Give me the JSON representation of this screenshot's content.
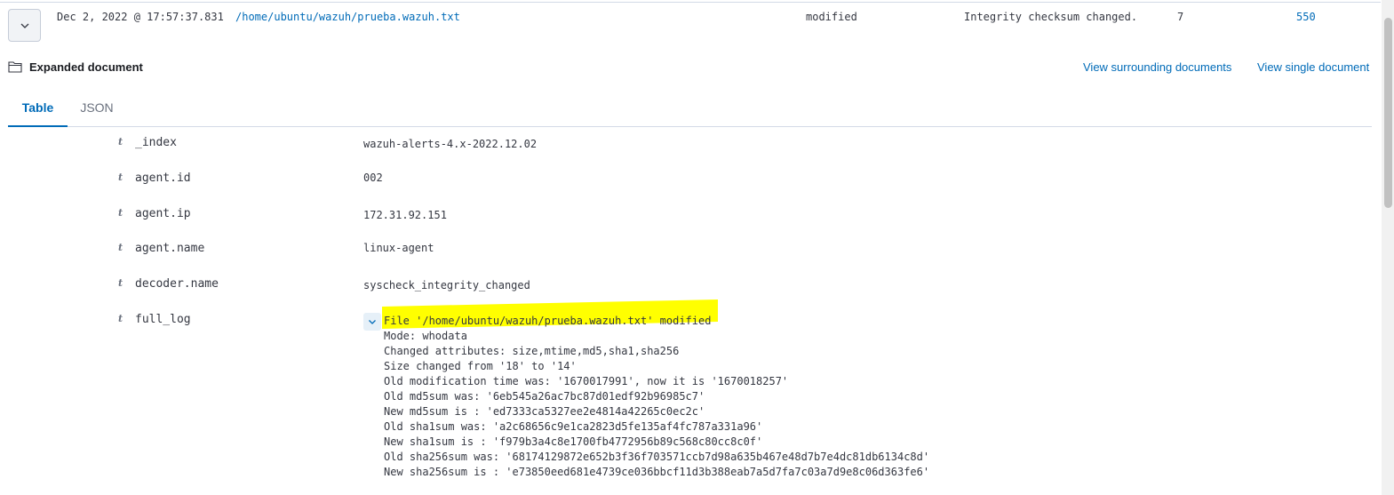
{
  "row": {
    "timestamp": "Dec 2, 2022 @ 17:57:37.831",
    "path": "/home/ubuntu/wazuh/prueba.wazuh.txt",
    "event": "modified",
    "description": "Integrity checksum changed.",
    "level": "7",
    "rule_id": "550"
  },
  "header": {
    "title": "Expanded document",
    "view_surrounding": "View surrounding documents",
    "view_single": "View single document"
  },
  "tabs": [
    {
      "label": "Table",
      "active": true
    },
    {
      "label": "JSON",
      "active": false
    }
  ],
  "fields": [
    {
      "type": "t",
      "name": "_index",
      "value": "wazuh-alerts-4.x-2022.12.02"
    },
    {
      "type": "t",
      "name": "agent.id",
      "value": "002"
    },
    {
      "type": "t",
      "name": "agent.ip",
      "value": "172.31.92.151"
    },
    {
      "type": "t",
      "name": "agent.name",
      "value": "linux-agent"
    },
    {
      "type": "t",
      "name": "decoder.name",
      "value": "syscheck_integrity_changed"
    },
    {
      "type": "t",
      "name": "full_log",
      "value": ""
    }
  ],
  "full_log": [
    "File '/home/ubuntu/wazuh/prueba.wazuh.txt' modified",
    "Mode: whodata",
    "Changed attributes: size,mtime,md5,sha1,sha256",
    "Size changed from '18' to '14'",
    "Old modification time was: '1670017991', now it is '1670018257'",
    "Old md5sum was: '6eb545a26ac7bc87d01edf92b96985c7'",
    "New md5sum is : 'ed7333ca5327ee2e4814a42265c0ec2c'",
    "Old sha1sum was: 'a2c68656c9e1ca2823d5fe135af4fc787a331a96'",
    "New sha1sum is : 'f979b3a4c8e1700fb4772956b89c568c80cc8c0f'",
    "Old sha256sum was: '68174129872e652b3f36f703571ccb7d98a635b467e48d7b7e4dc81db6134c8d'",
    "New sha256sum is : 'e73850eed681e4739ce036bbcf11d3b388eab7a5d7fa7c03a7d9e8c06d363fe6'"
  ],
  "colors": {
    "link": "#006bb8",
    "highlight": "#ffff00",
    "border": "#d3dae6"
  },
  "icons": [
    "chevron-down-icon",
    "folder-icon",
    "field-type-string-icon"
  ]
}
